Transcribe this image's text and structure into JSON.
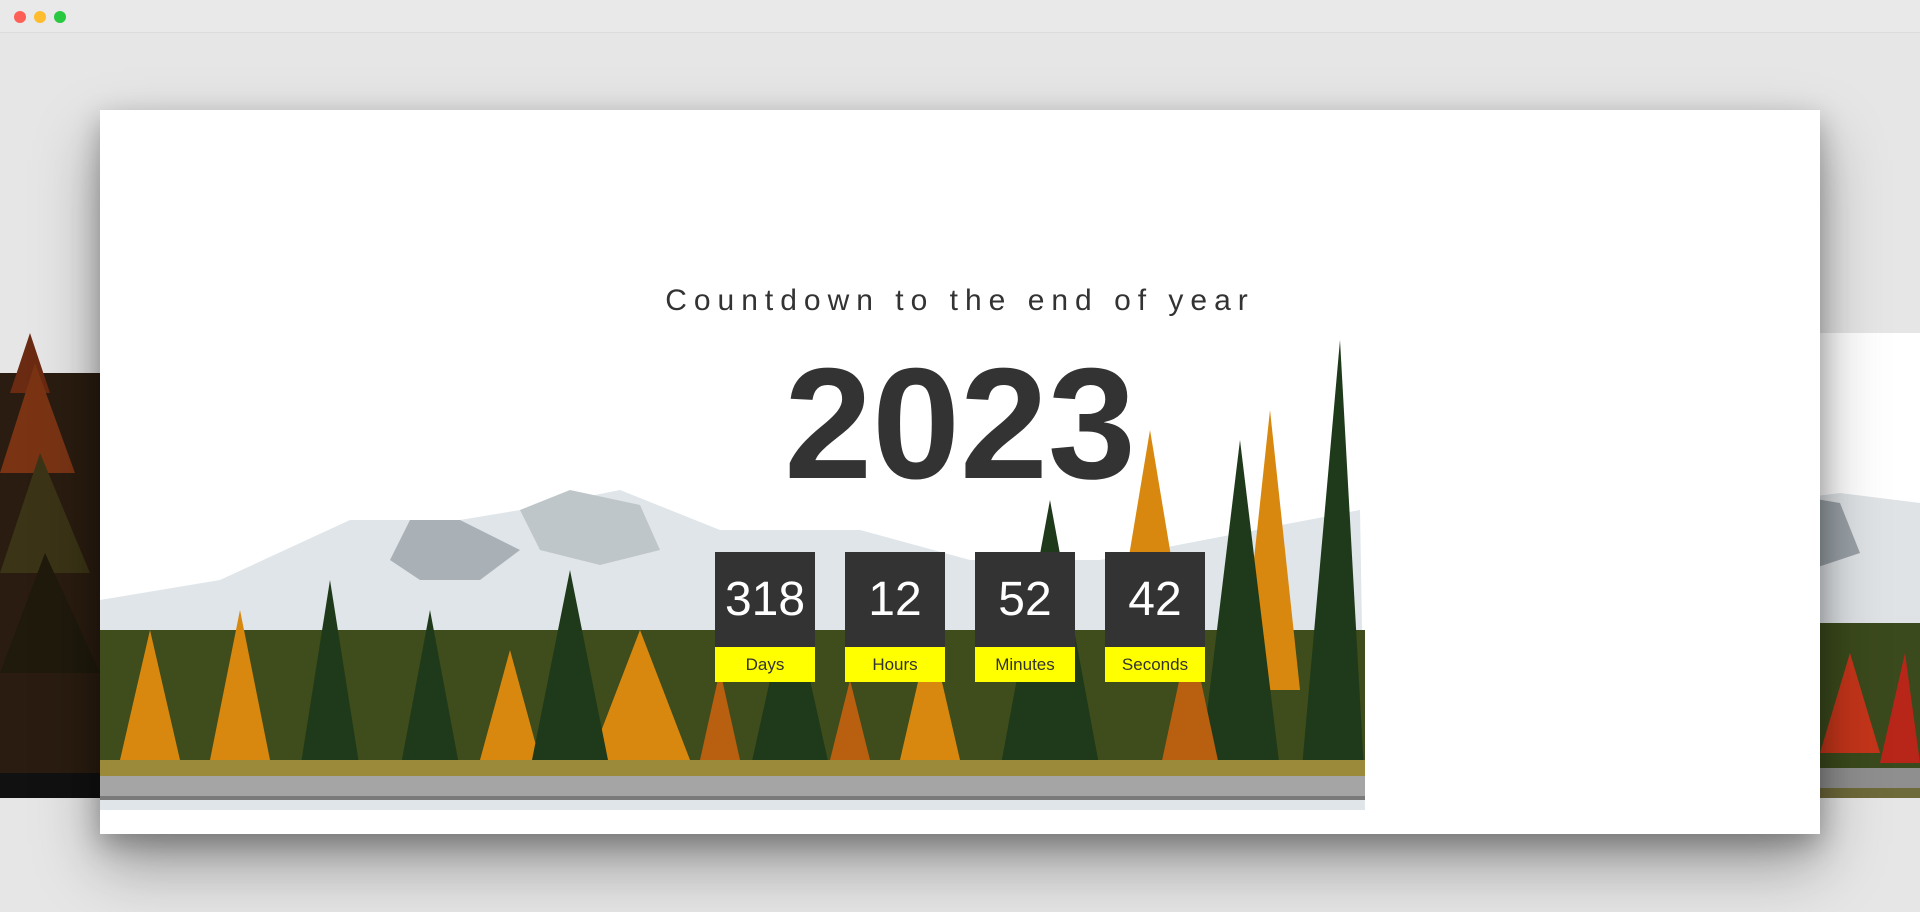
{
  "window": {
    "controls": [
      "close",
      "minimize",
      "zoom"
    ]
  },
  "page": {
    "heading": "Countdown to the end of year",
    "year": "2023"
  },
  "countdown": [
    {
      "value": "318",
      "label": "Days"
    },
    {
      "value": "12",
      "label": "Hours"
    },
    {
      "value": "52",
      "label": "Minutes"
    },
    {
      "value": "42",
      "label": "Seconds"
    }
  ],
  "colors": {
    "text": "#333333",
    "box": "#333333",
    "label_bg": "#ffff00",
    "card": "#ffffff",
    "backdrop": "#e6e6e6"
  },
  "background": {
    "scene": "autumn-forest-mountain-road-image"
  }
}
